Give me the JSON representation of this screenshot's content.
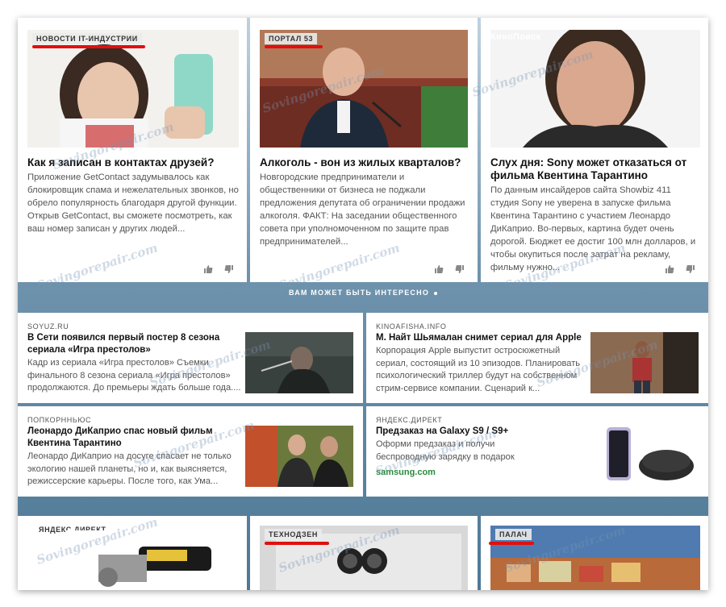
{
  "top_cards": [
    {
      "source": "НОВОСТИ IT-ИНДУСТРИИ",
      "title": "Как я записан в контактах друзей?",
      "text": "Приложение GetContact задумывалось как блокировщик спама и нежелательных звонков, но обрело популярность благодаря другой функции. Открыв GetContact, вы сможете посмотреть, как ваш номер записан у других людей..."
    },
    {
      "source": "ПОРТАЛ 53",
      "title": "Алкоголь - вон из жилых кварталов?",
      "text": "Новгородские предприниматели и общественники от бизнеса не поджали предложения депутата об ограничении продажи алкоголя. ФАКТ: На заседании общественного совета при уполномоченном по защите прав предпринимателей..."
    },
    {
      "source": "КиноПоиск",
      "title": "Слух дня: Sony может отказаться от фильма Квентина Тарантино",
      "text": "По данным инсайдеров сайта Showbiz 411 студия Sony не уверена в запуске фильма Квентина Тарантино с участием Леонардо ДиКаприо. Во-первых, картина будет очень дорогой. Бюджет ее достиг 100 млн долларов, и чтобы окупиться после затрат на рекламу, фильму нужно..."
    }
  ],
  "interesting_label": "ВАМ МОЖЕТ БЫТЬ ИНТЕРЕСНО",
  "mid_cards": [
    {
      "source": "SOYUZ.RU",
      "title": "В Сети появился первый постер 8 сезона сериала «Игра престолов»",
      "text": "Кадр из сериала «Игра престолов» Съемки финального 8 сезона сериала «Игра престолов» продолжаются. До премьеры ждать больше года...."
    },
    {
      "source": "KINOAFISHA.INFO",
      "title": "М. Найт Шьямалан снимет сериал для Apple",
      "text": "Корпорация Apple выпустит остросюжетный сериал, состоящий из 10 эпизодов. Планировать психологический триллер будут на собственном стрим-сервисе компании. Сценарий к..."
    },
    {
      "source": "ПОПКОРННЬЮС",
      "title": "Леонардо ДиКаприо спас новый фильм Квентина Тарантино",
      "text": "Леонардо ДиКаприо на досуге спасает не только экологию нашей планеты, но и, как выясняется, режиссерские карьеры. После того, как Ума..."
    },
    {
      "source": "ЯНДЕКС.ДИРЕКТ",
      "title": "Предзаказ на Galaxy S9 / S9+",
      "text": "Оформи предзаказ и получи беспроводную зарядку в подарок",
      "link": "samsung.com"
    }
  ],
  "bottom_cards": [
    {
      "source": "ЯНДЕКС.ДИРЕКТ"
    },
    {
      "source": "ТЕХНОДЗЕН"
    },
    {
      "source": "ПАЛАЧ"
    }
  ],
  "watermark": "Sovingorepair.com"
}
